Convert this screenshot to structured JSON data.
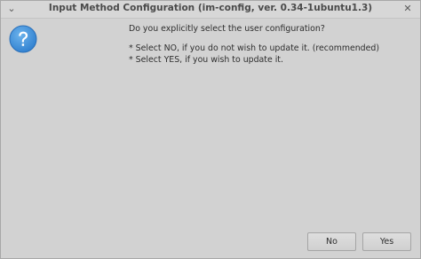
{
  "window": {
    "title": "Input Method Configuration (im-config, ver. 0.34-1ubuntu1.3)",
    "menu_icon": "chevron-down-icon",
    "close_icon": "close-icon",
    "close_glyph": "✕",
    "menu_glyph": "⌄"
  },
  "dialog": {
    "icon": "question-icon",
    "icon_color": "#3d8fd6",
    "question": "Do you explicitly select the user configuration?",
    "options": [
      "* Select NO, if you do not wish to update it. (recommended)",
      "* Select YES, if you wish to update it."
    ]
  },
  "buttons": {
    "no_label": "No",
    "yes_label": "Yes"
  }
}
